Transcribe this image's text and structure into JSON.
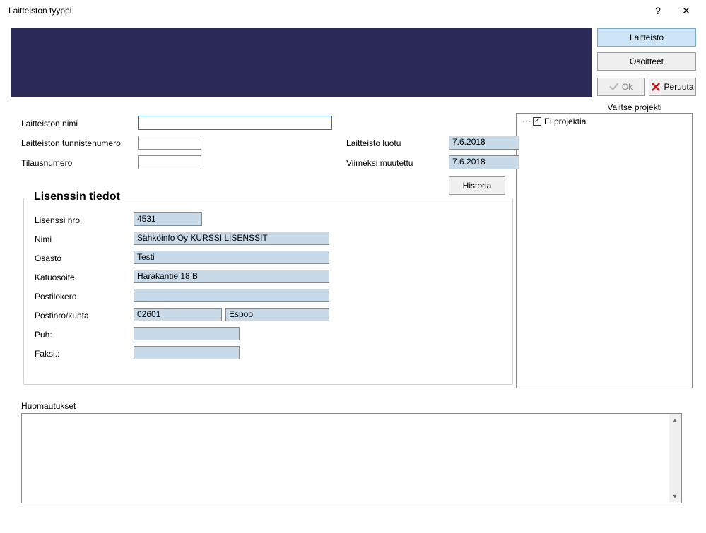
{
  "window": {
    "title": "Laitteiston tyyppi"
  },
  "top_buttons": {
    "laitteisto": "Laitteisto",
    "osoitteet": "Osoitteet",
    "ok": "Ok",
    "peruuta": "Peruuta"
  },
  "project": {
    "label": "Valitse projekti",
    "no_project": "Ei projektia",
    "no_project_checked": true
  },
  "main_fields": {
    "nimi_label": "Laitteiston nimi",
    "nimi_value": "",
    "tunniste_label": "Laitteiston tunnistenumero",
    "tunniste_value": "",
    "tilaus_label": "Tilausnumero",
    "tilaus_value": "",
    "luotu_label": "Laitteisto luotu",
    "luotu_value": "7.6.2018",
    "muutettu_label": "Viimeksi muutettu",
    "muutettu_value": "7.6.2018",
    "historia": "Historia"
  },
  "lisenssi": {
    "legend": "Lisenssin tiedot",
    "nro_label": "Lisenssi nro.",
    "nro_value": "4531",
    "nimi_label": "Nimi",
    "nimi_value": "Sähköinfo Oy KURSSI LISENSSIT",
    "osasto_label": "Osasto",
    "osasto_value": "Testi",
    "katu_label": "Katuosoite",
    "katu_value": "Harakantie 18 B",
    "lokero_label": "Postilokero",
    "lokero_value": "",
    "postinro_label": "Postinro/kunta",
    "postinro_value": "02601",
    "kunta_value": "Espoo",
    "puh_label": "Puh:",
    "puh_value": "",
    "faksi_label": "Faksi.:",
    "faksi_value": ""
  },
  "notes": {
    "label": "Huomautukset",
    "value": ""
  }
}
